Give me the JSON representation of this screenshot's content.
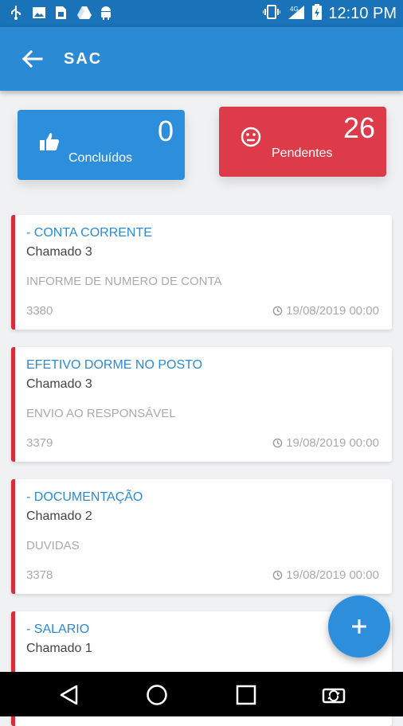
{
  "status_bar": {
    "time": "12:10 PM",
    "network": "4G",
    "icons": [
      "usb-icon",
      "image-icon",
      "sim-icon",
      "drive-icon",
      "android-icon",
      "vibrate-icon",
      "signal-icon",
      "battery-icon"
    ]
  },
  "app_bar": {
    "title": "SAC",
    "back_icon": "arrow-left-icon"
  },
  "stats": {
    "concluidos": {
      "count": "0",
      "label": "Concluídos",
      "icon": "thumbs-up-icon",
      "color": "#2d8fdc"
    },
    "pendentes": {
      "count": "26",
      "label": "Pendentes",
      "icon": "neutral-face-icon",
      "color": "#de3b4a"
    }
  },
  "tickets": [
    {
      "subject": "- CONTA CORRENTE",
      "chamado": "Chamado 3",
      "description": "INFORME DE NUMERO DE CONTA",
      "id": "3380",
      "date": "19/08/2019 00:00"
    },
    {
      "subject": "EFETIVO DORME NO POSTO",
      "chamado": "Chamado 3",
      "description": "ENVIO AO RESPONSÁVEL",
      "id": "3379",
      "date": "19/08/2019 00:00"
    },
    {
      "subject": "- DOCUMENTAÇÃO",
      "chamado": "Chamado 2",
      "description": "DUVIDAS",
      "id": "3378",
      "date": "19/08/2019 00:00"
    },
    {
      "subject": "- SALARIO",
      "chamado": "Chamado 1",
      "description": "",
      "id": "",
      "date": ""
    }
  ],
  "fab": {
    "icon": "plus-icon"
  },
  "nav_bar": {
    "icons": [
      "back-triangle-icon",
      "home-circle-icon",
      "recents-square-icon",
      "rotate-icon"
    ]
  },
  "colors": {
    "primary": "#2a8ad4",
    "status_bar": "#1a72b8",
    "accent_red": "#de3b4a",
    "card_border": "#d62c3c"
  }
}
